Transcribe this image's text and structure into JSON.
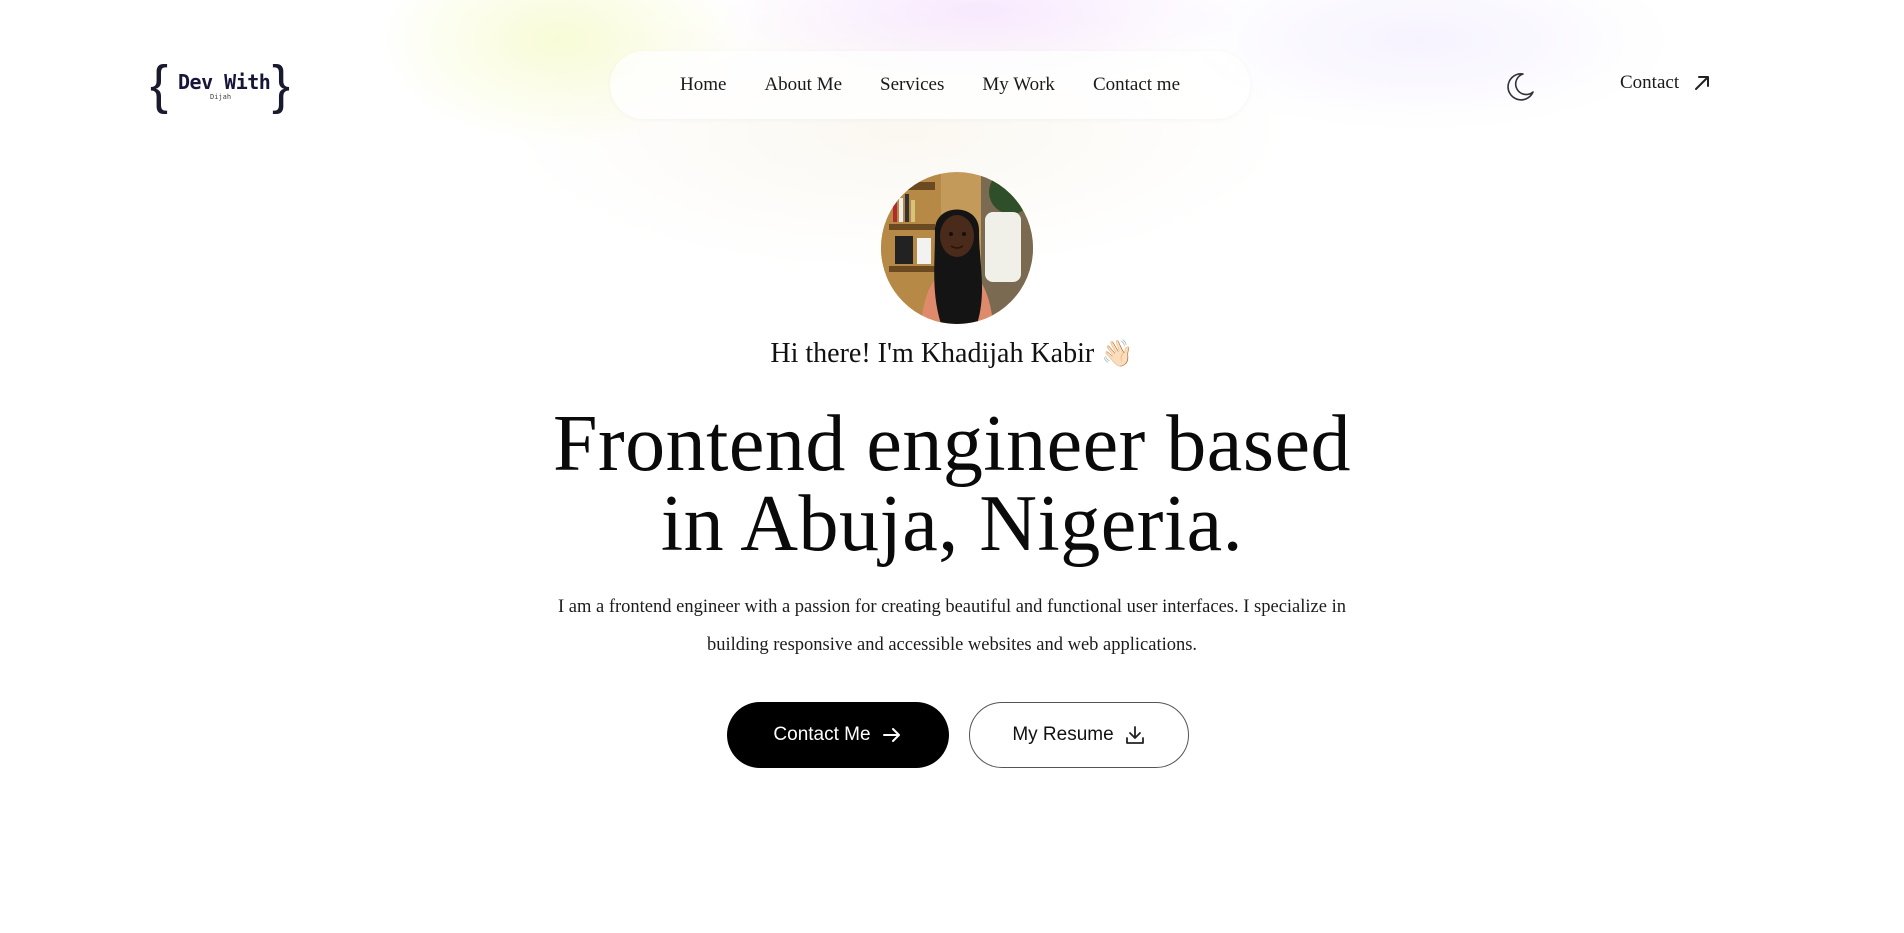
{
  "logo": {
    "title": "Dev With",
    "subtitle": "Dijah"
  },
  "nav": {
    "items": [
      {
        "label": "Home"
      },
      {
        "label": "About Me"
      },
      {
        "label": "Services"
      },
      {
        "label": "My Work"
      },
      {
        "label": "Contact me"
      }
    ]
  },
  "header": {
    "theme_toggle_icon": "moon-icon",
    "contact_label": "Contact",
    "contact_icon": "arrow-up-right-icon"
  },
  "hero": {
    "greeting": "Hi there! I'm Khadijah Kabir",
    "greeting_emoji": "👋🏻",
    "headline_line1": "Frontend engineer based",
    "headline_line2": "in Abuja, Nigeria.",
    "intro": "I am a frontend engineer with a passion for creating beautiful and functional user interfaces. I specialize in building responsive and accessible websites and web applications.",
    "primary_button": "Contact Me",
    "primary_icon": "arrow-right-icon",
    "secondary_button": "My Resume",
    "secondary_icon": "download-icon"
  },
  "colors": {
    "primary_button_bg": "#000000",
    "text": "#111111",
    "background": "#ffffff"
  }
}
